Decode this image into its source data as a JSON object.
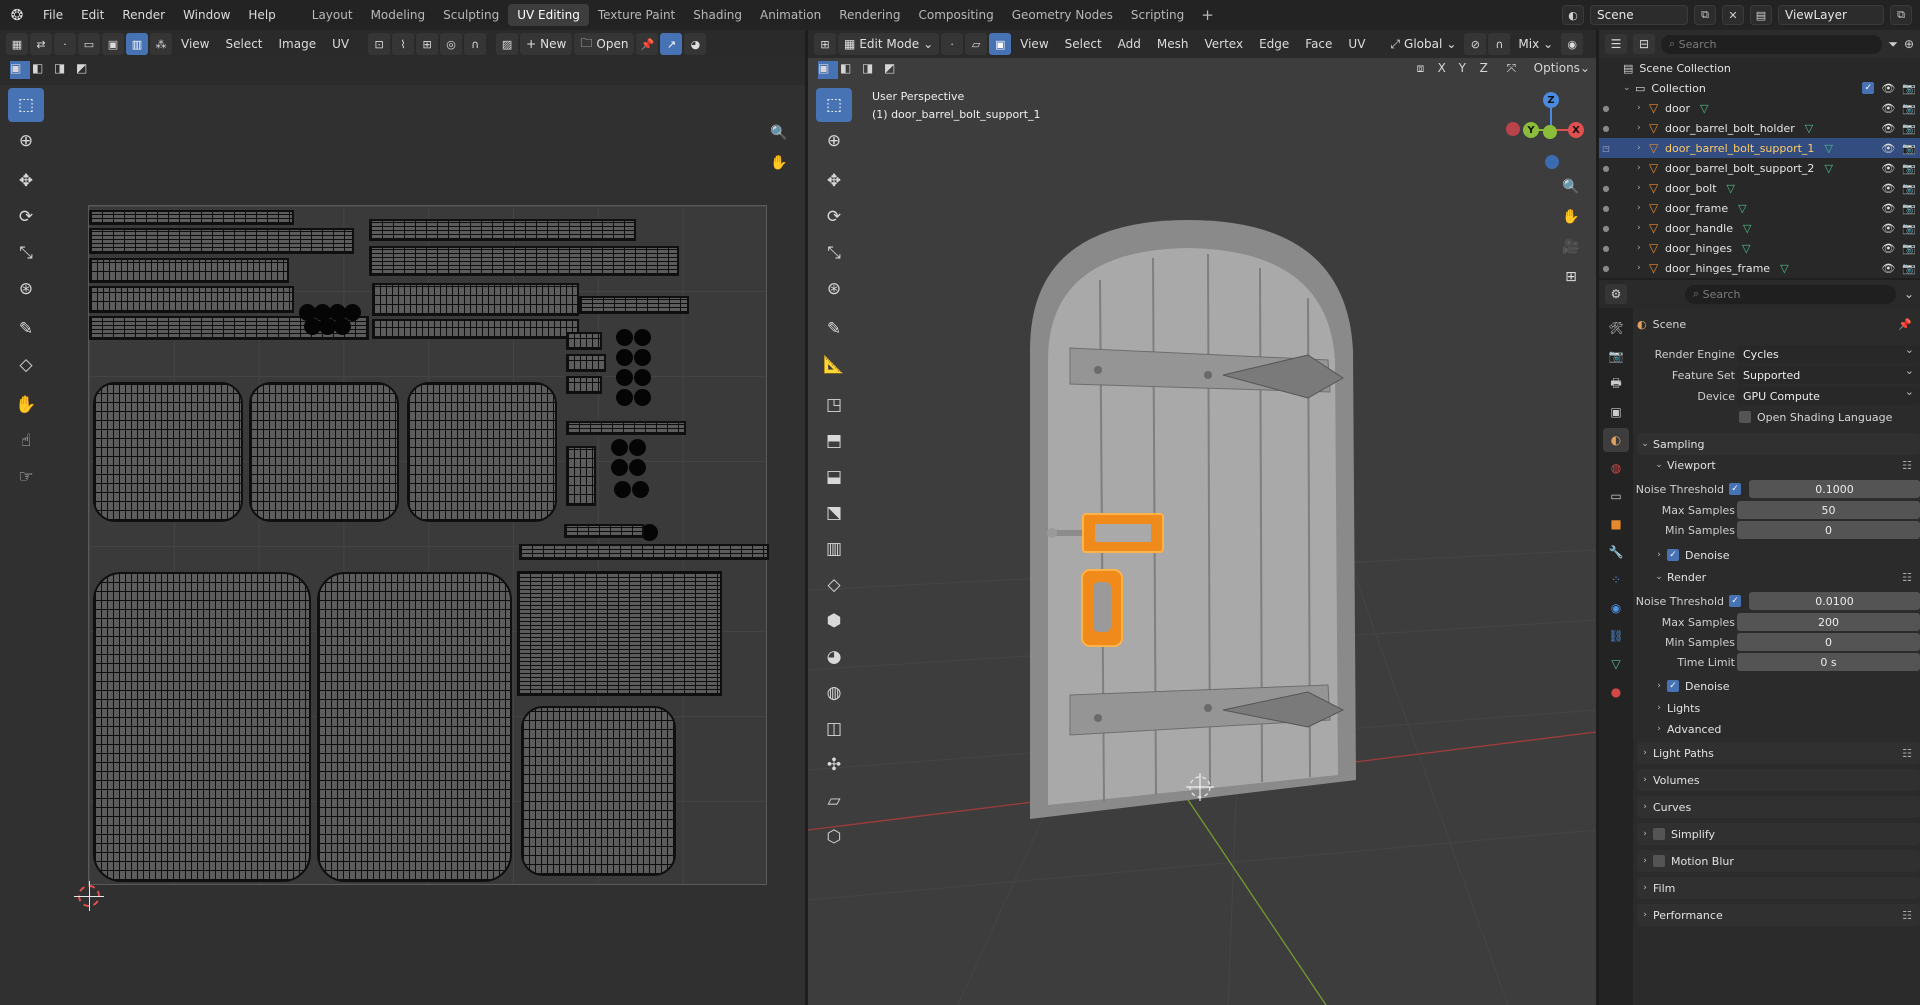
{
  "menu": {
    "file": "File",
    "edit": "Edit",
    "render": "Render",
    "window": "Window",
    "help": "Help"
  },
  "workspaces": [
    "Layout",
    "Modeling",
    "Sculpting",
    "UV Editing",
    "Texture Paint",
    "Shading",
    "Animation",
    "Rendering",
    "Compositing",
    "Geometry Nodes",
    "Scripting"
  ],
  "active_workspace": "UV Editing",
  "scene": {
    "name": "Scene",
    "view_layer": "ViewLayer"
  },
  "uv_editor": {
    "menus": [
      "View",
      "Select",
      "Image",
      "UV"
    ],
    "new_label": "New",
    "open_label": "Open"
  },
  "viewport": {
    "mode": "Edit Mode",
    "menus": [
      "View",
      "Select",
      "Add",
      "Mesh",
      "Vertex",
      "Edge",
      "Face",
      "UV"
    ],
    "orientation": "Global",
    "mix": "Mix",
    "axes": [
      "X",
      "Y",
      "Z"
    ],
    "options_label": "Options",
    "perspective_label": "User Perspective",
    "object_label": "(1) door_barrel_bolt_support_1",
    "gizmo": {
      "z": "Z",
      "y": "Y",
      "x": "X"
    }
  },
  "outliner": {
    "search_placeholder": "Search",
    "scene_collection": "Scene Collection",
    "collection": "Collection",
    "objects": [
      "door",
      "door_barrel_bolt_holder",
      "door_barrel_bolt_support_1",
      "door_barrel_bolt_support_2",
      "door_bolt",
      "door_frame",
      "door_handle",
      "door_hinges",
      "door_hinges_frame"
    ],
    "selected": "door_barrel_bolt_support_1"
  },
  "properties": {
    "search_placeholder": "Search",
    "context": "Scene",
    "render_engine": {
      "label": "Render Engine",
      "value": "Cycles"
    },
    "feature_set": {
      "label": "Feature Set",
      "value": "Supported"
    },
    "device": {
      "label": "Device",
      "value": "GPU Compute"
    },
    "osl": "Open Shading Language",
    "sampling": "Sampling",
    "viewport": {
      "title": "Viewport",
      "noise_threshold": {
        "label": "Noise Threshold",
        "value": "0.1000"
      },
      "max_samples": {
        "label": "Max Samples",
        "value": "50"
      },
      "min_samples": {
        "label": "Min Samples",
        "value": "0"
      },
      "denoise": "Denoise"
    },
    "render": {
      "title": "Render",
      "noise_threshold": {
        "label": "Noise Threshold",
        "value": "0.0100"
      },
      "max_samples": {
        "label": "Max Samples",
        "value": "200"
      },
      "min_samples": {
        "label": "Min Samples",
        "value": "0"
      },
      "time_limit": {
        "label": "Time Limit",
        "value": "0 s"
      },
      "denoise": "Denoise"
    },
    "subpanels": [
      "Lights",
      "Advanced"
    ],
    "panels": [
      "Light Paths",
      "Volumes",
      "Curves",
      "Simplify",
      "Motion Blur",
      "Film",
      "Performance"
    ]
  },
  "colors": {
    "accent": "#4772b3",
    "selection": "#ff8a00",
    "object_icon": "#e68a2e",
    "mesh_icon": "#4fc38a"
  }
}
